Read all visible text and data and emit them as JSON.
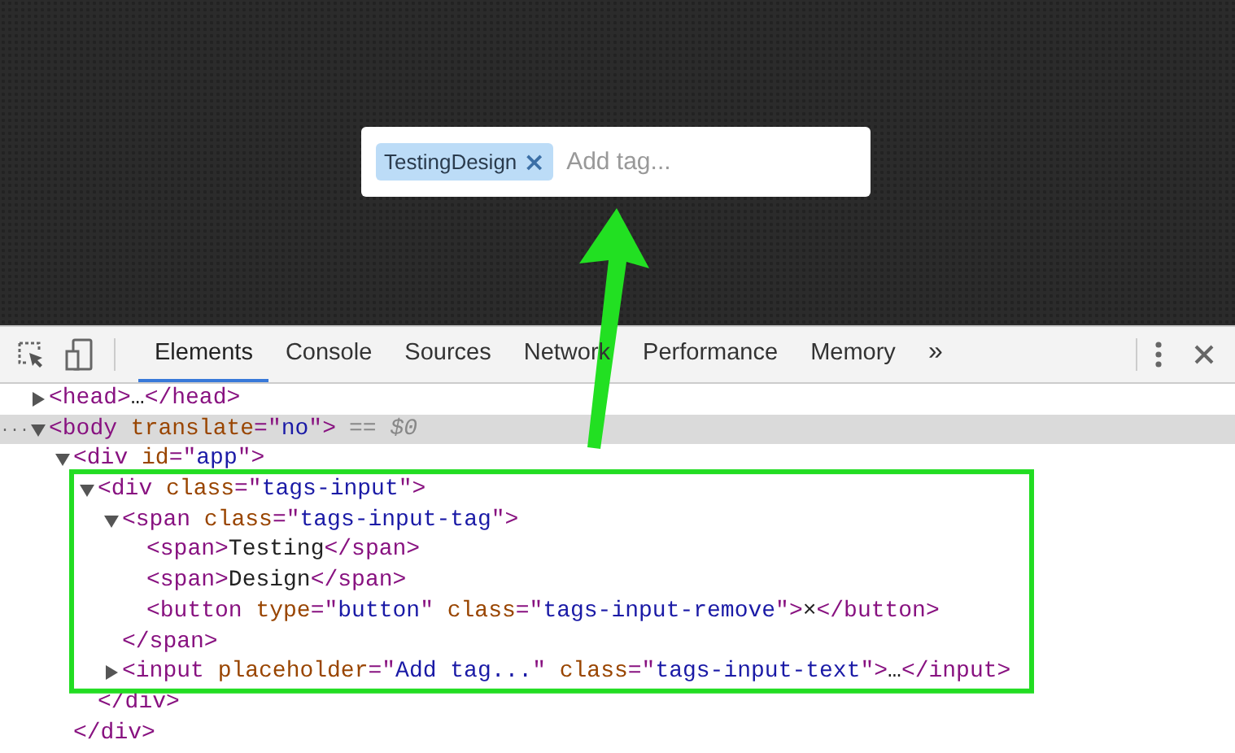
{
  "demo": {
    "tags": [
      {
        "label": "TestingDesign",
        "remove": "×"
      }
    ],
    "input": {
      "placeholder": "Add tag..."
    }
  },
  "devtools": {
    "tabs": [
      {
        "label": "Elements",
        "selected": true
      },
      {
        "label": "Console",
        "selected": false
      },
      {
        "label": "Sources",
        "selected": false
      },
      {
        "label": "Network",
        "selected": false
      },
      {
        "label": "Performance",
        "selected": false
      },
      {
        "label": "Memory",
        "selected": false
      }
    ],
    "overflow": "»"
  },
  "dom_tree": [
    {
      "expanded": false,
      "selected": false,
      "tokens": [
        {
          "kind": "tag",
          "text": "<head>"
        },
        {
          "kind": "text",
          "text": "…"
        },
        {
          "kind": "tag",
          "text": "</head>"
        }
      ]
    },
    {
      "expanded": true,
      "selected": true,
      "prefix": "...",
      "suffix": "== $0",
      "tokens": [
        {
          "kind": "tag",
          "text": "<body "
        },
        {
          "kind": "attr",
          "text": "translate"
        },
        {
          "kind": "punct",
          "text": "=\""
        },
        {
          "kind": "value",
          "text": "no"
        },
        {
          "kind": "punct",
          "text": "\""
        },
        {
          "kind": "tag",
          "text": ">"
        }
      ],
      "children": [
        {
          "expanded": true,
          "selected": false,
          "tokens": [
            {
              "kind": "tag",
              "text": "<div "
            },
            {
              "kind": "attr",
              "text": "id"
            },
            {
              "kind": "punct",
              "text": "=\""
            },
            {
              "kind": "value",
              "text": "app"
            },
            {
              "kind": "punct",
              "text": "\""
            },
            {
              "kind": "tag",
              "text": ">"
            }
          ],
          "closing": [
            {
              "kind": "tag",
              "text": "</div>"
            }
          ],
          "children": [
            {
              "expanded": true,
              "selected": false,
              "tokens": [
                {
                  "kind": "tag",
                  "text": "<div "
                },
                {
                  "kind": "attr",
                  "text": "class"
                },
                {
                  "kind": "punct",
                  "text": "=\""
                },
                {
                  "kind": "value",
                  "text": "tags-input"
                },
                {
                  "kind": "punct",
                  "text": "\""
                },
                {
                  "kind": "tag",
                  "text": ">"
                }
              ],
              "closing": [
                {
                  "kind": "tag",
                  "text": "</div>"
                }
              ],
              "children": [
                {
                  "expanded": true,
                  "selected": false,
                  "tokens": [
                    {
                      "kind": "tag",
                      "text": "<span "
                    },
                    {
                      "kind": "attr",
                      "text": "class"
                    },
                    {
                      "kind": "punct",
                      "text": "=\""
                    },
                    {
                      "kind": "value",
                      "text": "tags-input-tag"
                    },
                    {
                      "kind": "punct",
                      "text": "\""
                    },
                    {
                      "kind": "tag",
                      "text": ">"
                    }
                  ],
                  "closing": [
                    {
                      "kind": "tag",
                      "text": "</span>"
                    }
                  ],
                  "children": [
                    {
                      "selected": false,
                      "tokens": [
                        {
                          "kind": "tag",
                          "text": "<span>"
                        },
                        {
                          "kind": "text",
                          "text": "Testing"
                        },
                        {
                          "kind": "tag",
                          "text": "</span>"
                        }
                      ]
                    },
                    {
                      "selected": false,
                      "tokens": [
                        {
                          "kind": "tag",
                          "text": "<span>"
                        },
                        {
                          "kind": "text",
                          "text": "Design"
                        },
                        {
                          "kind": "tag",
                          "text": "</span>"
                        }
                      ]
                    },
                    {
                      "selected": false,
                      "tokens": [
                        {
                          "kind": "tag",
                          "text": "<button "
                        },
                        {
                          "kind": "attr",
                          "text": "type"
                        },
                        {
                          "kind": "punct",
                          "text": "=\""
                        },
                        {
                          "kind": "value",
                          "text": "button"
                        },
                        {
                          "kind": "punct",
                          "text": "\" "
                        },
                        {
                          "kind": "attr",
                          "text": "class"
                        },
                        {
                          "kind": "punct",
                          "text": "=\""
                        },
                        {
                          "kind": "value",
                          "text": "tags-input-remove"
                        },
                        {
                          "kind": "punct",
                          "text": "\""
                        },
                        {
                          "kind": "tag",
                          "text": ">"
                        },
                        {
                          "kind": "text",
                          "text": "×"
                        },
                        {
                          "kind": "tag",
                          "text": "</button>"
                        }
                      ]
                    }
                  ]
                },
                {
                  "expanded": false,
                  "selected": false,
                  "tokens": [
                    {
                      "kind": "tag",
                      "text": "<input "
                    },
                    {
                      "kind": "attr",
                      "text": "placeholder"
                    },
                    {
                      "kind": "punct",
                      "text": "=\""
                    },
                    {
                      "kind": "value",
                      "text": "Add tag..."
                    },
                    {
                      "kind": "punct",
                      "text": "\" "
                    },
                    {
                      "kind": "attr",
                      "text": "class"
                    },
                    {
                      "kind": "punct",
                      "text": "=\""
                    },
                    {
                      "kind": "value",
                      "text": "tags-input-text"
                    },
                    {
                      "kind": "punct",
                      "text": "\""
                    },
                    {
                      "kind": "tag",
                      "text": ">"
                    },
                    {
                      "kind": "text",
                      "text": "…"
                    },
                    {
                      "kind": "tag",
                      "text": "</input>"
                    }
                  ]
                }
              ]
            }
          ]
        }
      ]
    }
  ]
}
